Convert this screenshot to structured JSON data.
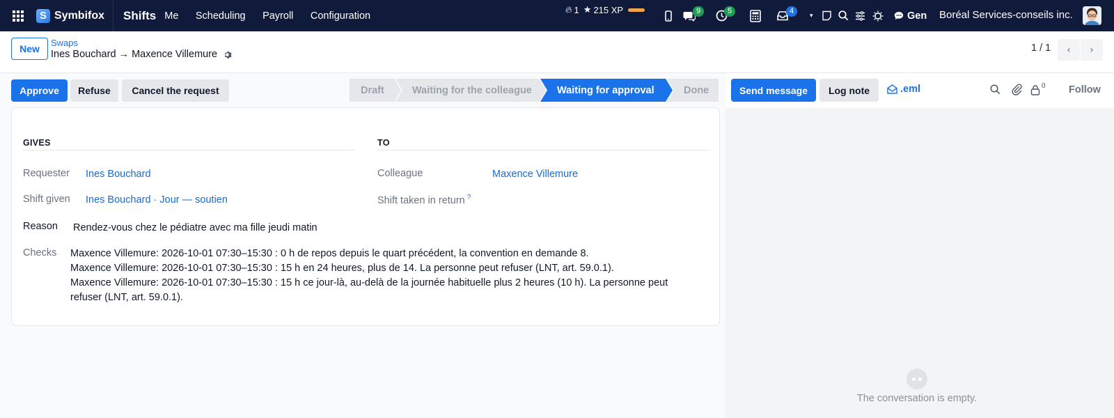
{
  "navbar": {
    "brand": "Symbifox",
    "brand_mark": "S",
    "app_name": "Shifts",
    "menu": [
      "Me",
      "Scheduling",
      "Payroll",
      "Configuration"
    ],
    "xp_streak": "1",
    "xp_points": "215 XP",
    "messages_count": "9",
    "activities_count": "5",
    "inbox_count": "4",
    "chat_label": "Gen",
    "company": "Boréal Services-conseils inc.",
    "colors": {
      "navbar_bg": "#101a3b",
      "badge_green": "#1f9d55",
      "badge_blue": "#1a73e8"
    }
  },
  "control": {
    "new_label": "New",
    "breadcrumb": "Swaps",
    "record_title": "Ines Bouchard → Maxence Villemure",
    "pager": "1 / 1"
  },
  "actions": {
    "approve": "Approve",
    "refuse": "Refuse",
    "cancel": "Cancel the request"
  },
  "status_steps": [
    {
      "label": "Draft",
      "active": false
    },
    {
      "label": "Waiting for the colleague",
      "active": false
    },
    {
      "label": "Waiting for approval",
      "active": true
    },
    {
      "label": "Done",
      "active": false
    }
  ],
  "form": {
    "gives_title": "GIVES",
    "to_title": "TO",
    "requester_label": "Requester",
    "requester_value": "Ines Bouchard",
    "shift_given_label": "Shift given",
    "shift_given_value": "Ines Bouchard · Jour — soutien",
    "colleague_label": "Colleague",
    "colleague_value": "Maxence Villemure",
    "shift_taken_label": "Shift taken in return",
    "shift_taken_help": "?",
    "reason_label": "Reason",
    "reason_value": "Rendez-vous chez le pédiatre avec ma fille jeudi matin",
    "checks_label": "Checks",
    "checks": [
      "Maxence Villemure: 2026-10-01 07:30–15:30 : 0 h de repos depuis le quart précédent, la convention en demande 8.",
      "Maxence Villemure: 2026-10-01 07:30–15:30 : 15 h en 24 heures, plus de 14. La personne peut refuser (LNT, art. 59.0.1).",
      "Maxence Villemure: 2026-10-01 07:30–15:30 : 15 h ce jour-là, au-delà de la journée habituelle plus 2 heures (10 h). La personne peut refuser (LNT, art. 59.0.1)."
    ]
  },
  "chatter": {
    "send_message": "Send message",
    "log_note": "Log note",
    "eml": ".eml",
    "followers_count": "0",
    "follow": "Follow",
    "empty": "The conversation is empty."
  }
}
